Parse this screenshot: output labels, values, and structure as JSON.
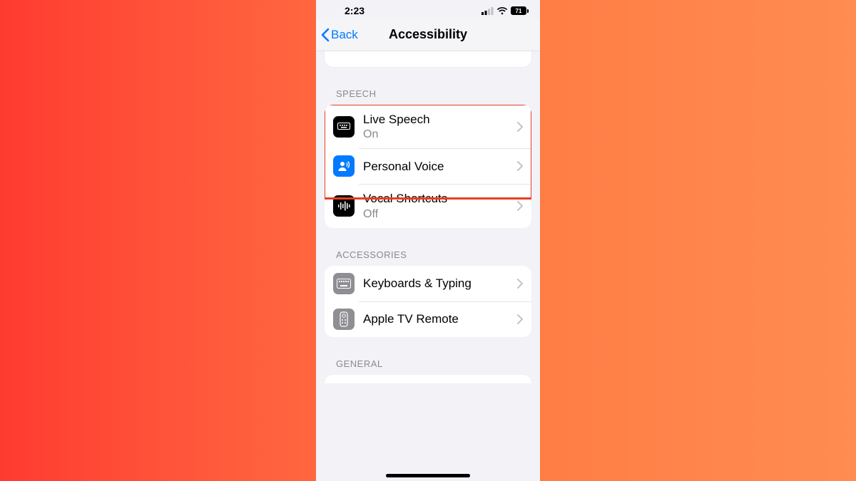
{
  "statusbar": {
    "time": "2:23",
    "battery": "71"
  },
  "nav": {
    "back": "Back",
    "title": "Accessibility"
  },
  "sections": {
    "speech": {
      "header": "SPEECH",
      "live_speech": {
        "label": "Live Speech",
        "sub": "On"
      },
      "personal_voice": {
        "label": "Personal Voice"
      },
      "vocal_shortcuts": {
        "label": "Vocal Shortcuts",
        "sub": "Off"
      }
    },
    "accessories": {
      "header": "ACCESSORIES",
      "keyboards": {
        "label": "Keyboards & Typing"
      },
      "apple_tv": {
        "label": "Apple TV Remote"
      }
    },
    "general": {
      "header": "GENERAL"
    }
  }
}
